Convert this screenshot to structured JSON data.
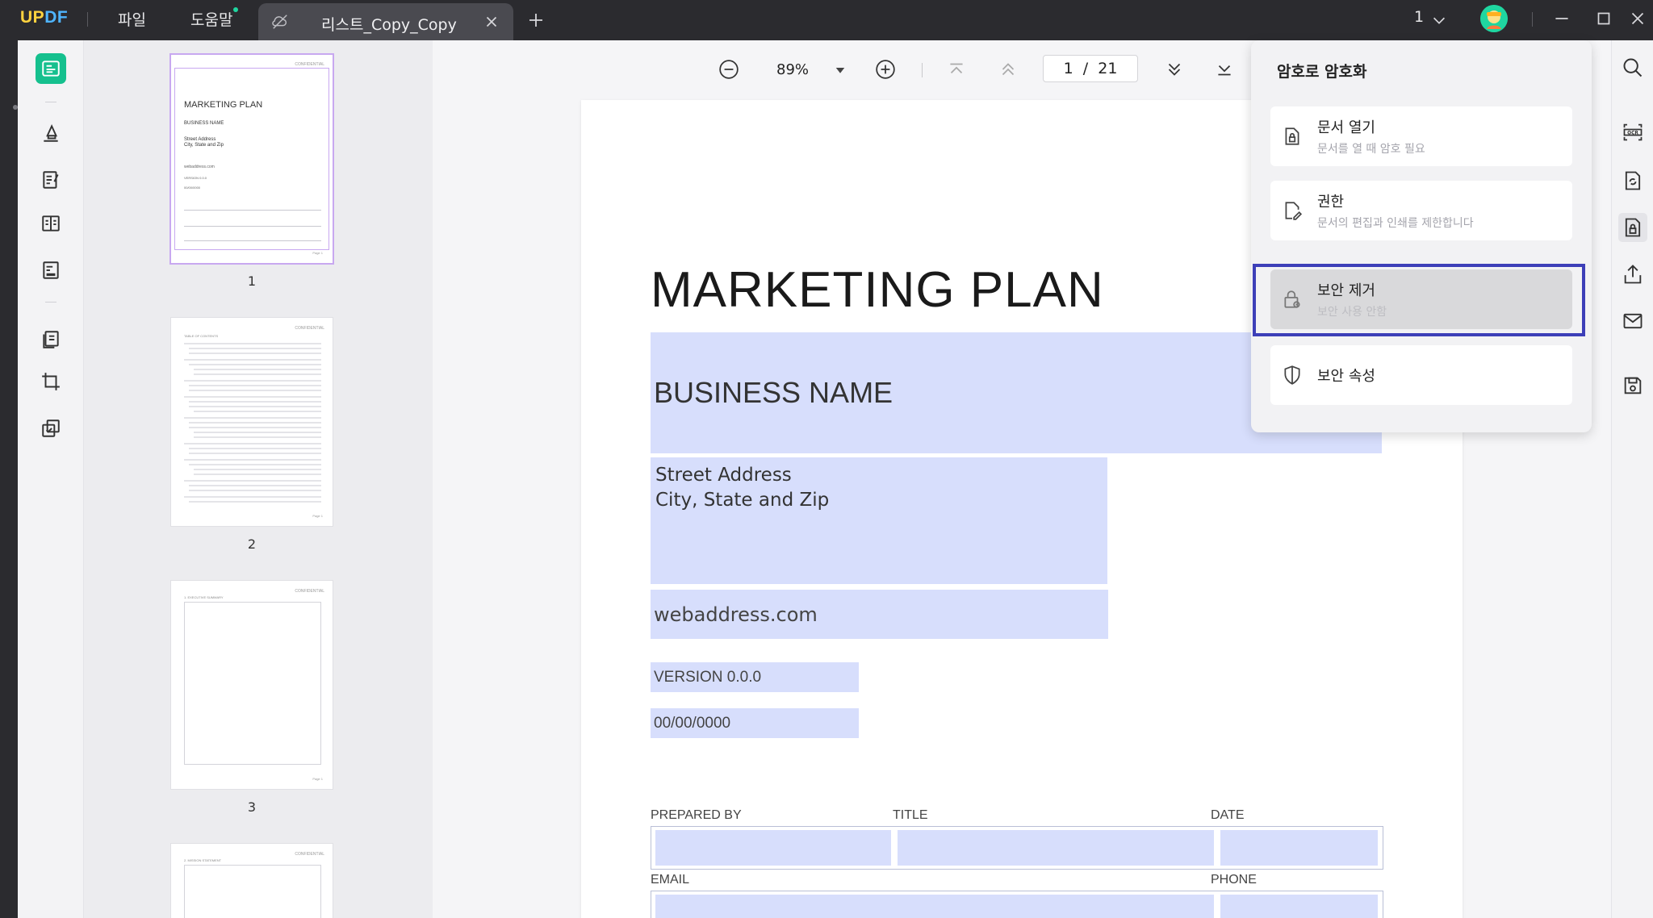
{
  "app": {
    "logo": {
      "up": "UP",
      "df": "DF"
    },
    "menu": {
      "file": "파일",
      "help": "도움말"
    },
    "tab": {
      "title": "리스트_Copy_Copy"
    },
    "window_count": "1"
  },
  "viewer": {
    "zoom": "89%",
    "page_current": "1",
    "page_separator": "/",
    "page_total": "21"
  },
  "thumbnails": [
    {
      "number": "1"
    },
    {
      "number": "2"
    },
    {
      "number": "3"
    }
  ],
  "thumb_text": {
    "confidential": "CONFIDENTIAL",
    "title": "MARKETING PLAN",
    "business": "BUSINESS NAME",
    "address1": "Street Address",
    "address2": "City, State and Zip",
    "web": "webaddress.com",
    "version": "VERSION 0.0.0",
    "date": "00/00/0000",
    "toc": "TABLE OF CONTENTS",
    "exec": "1. EXECUTIVE SUMMARY",
    "mission": "2. MISSION STATEMENT",
    "page": "Page 1"
  },
  "document": {
    "title": "MARKETING PLAN",
    "business_name": "BUSINESS NAME",
    "address_line1": "Street Address",
    "address_line2": "City, State and Zip",
    "web_address": "webaddress.com",
    "version": "VERSION 0.0.0",
    "date": "00/00/0000",
    "form": {
      "prepared_by": "PREPARED BY",
      "title": "TITLE",
      "date": "DATE",
      "email": "EMAIL",
      "phone": "PHONE"
    }
  },
  "security_panel": {
    "title": "암호로 암호화",
    "items": [
      {
        "title": "문서 열기",
        "subtitle": "문서를 열 때 암호 필요",
        "icon": "doc-lock-icon"
      },
      {
        "title": "권한",
        "subtitle": "문서의 편집과 인쇄를 제한합니다",
        "icon": "doc-edit-icon"
      },
      {
        "title": "보안 제거",
        "subtitle": "보안 사용 안함",
        "icon": "unlock-icon"
      },
      {
        "title": "보안 속성",
        "icon": "shield-icon"
      }
    ]
  },
  "colors": {
    "accent_green": "#15c08e",
    "highlight_frame": "#3d3fb8",
    "field_fill": "#d7defc"
  }
}
